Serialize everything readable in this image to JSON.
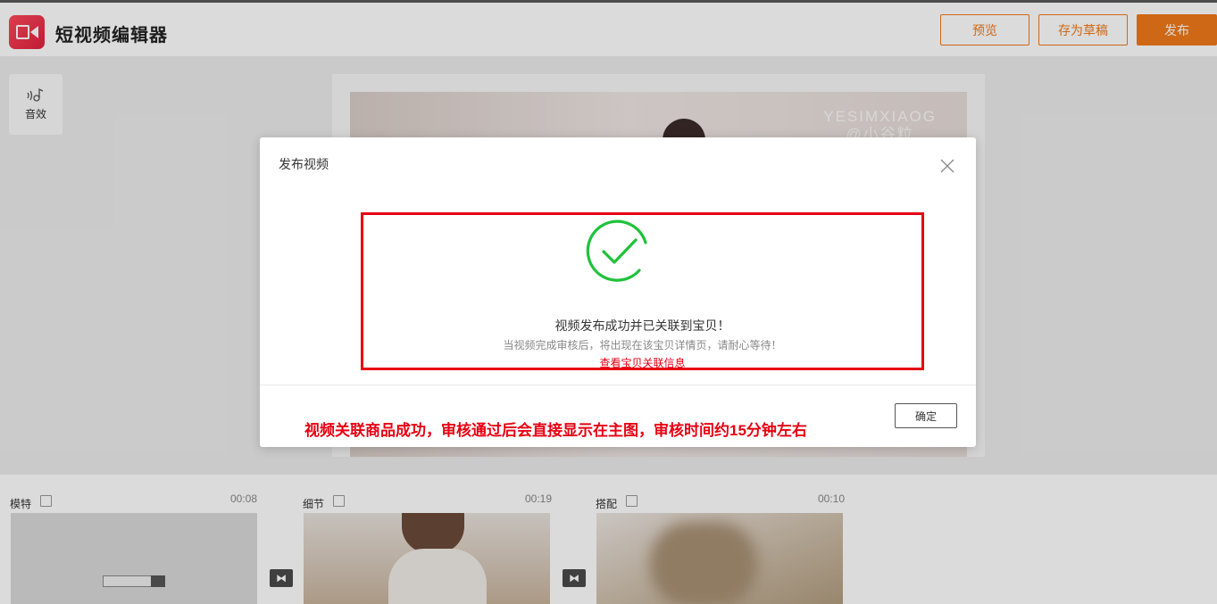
{
  "header": {
    "title": "短视频编辑器",
    "buttons": {
      "preview": "预览",
      "draft": "存为草稿",
      "publish": "发布"
    },
    "accent_color": "#f07a1a"
  },
  "toolbar": {
    "sound_effect_label": "音效"
  },
  "preview": {
    "watermark_line1": "YESIMXIAOG",
    "watermark_line2": "@小谷粒"
  },
  "timeline": {
    "clips": [
      {
        "label": "模特",
        "duration": "00:08"
      },
      {
        "label": "细节",
        "duration": "00:19"
      },
      {
        "label": "搭配",
        "duration": "00:10"
      }
    ]
  },
  "modal": {
    "title": "发布视频",
    "success_title": "视频发布成功并已关联到宝贝！",
    "success_subtitle": "当视频完成审核后，将出现在该宝贝详情页，请耐心等待！",
    "success_link": "查看宝贝关联信息",
    "annotation": "视频关联商品成功，审核通过后会直接显示在主图，审核时间约15分钟左右",
    "confirm_label": "确定",
    "success_color": "#1fc23a",
    "highlight_color": "#e60012"
  }
}
